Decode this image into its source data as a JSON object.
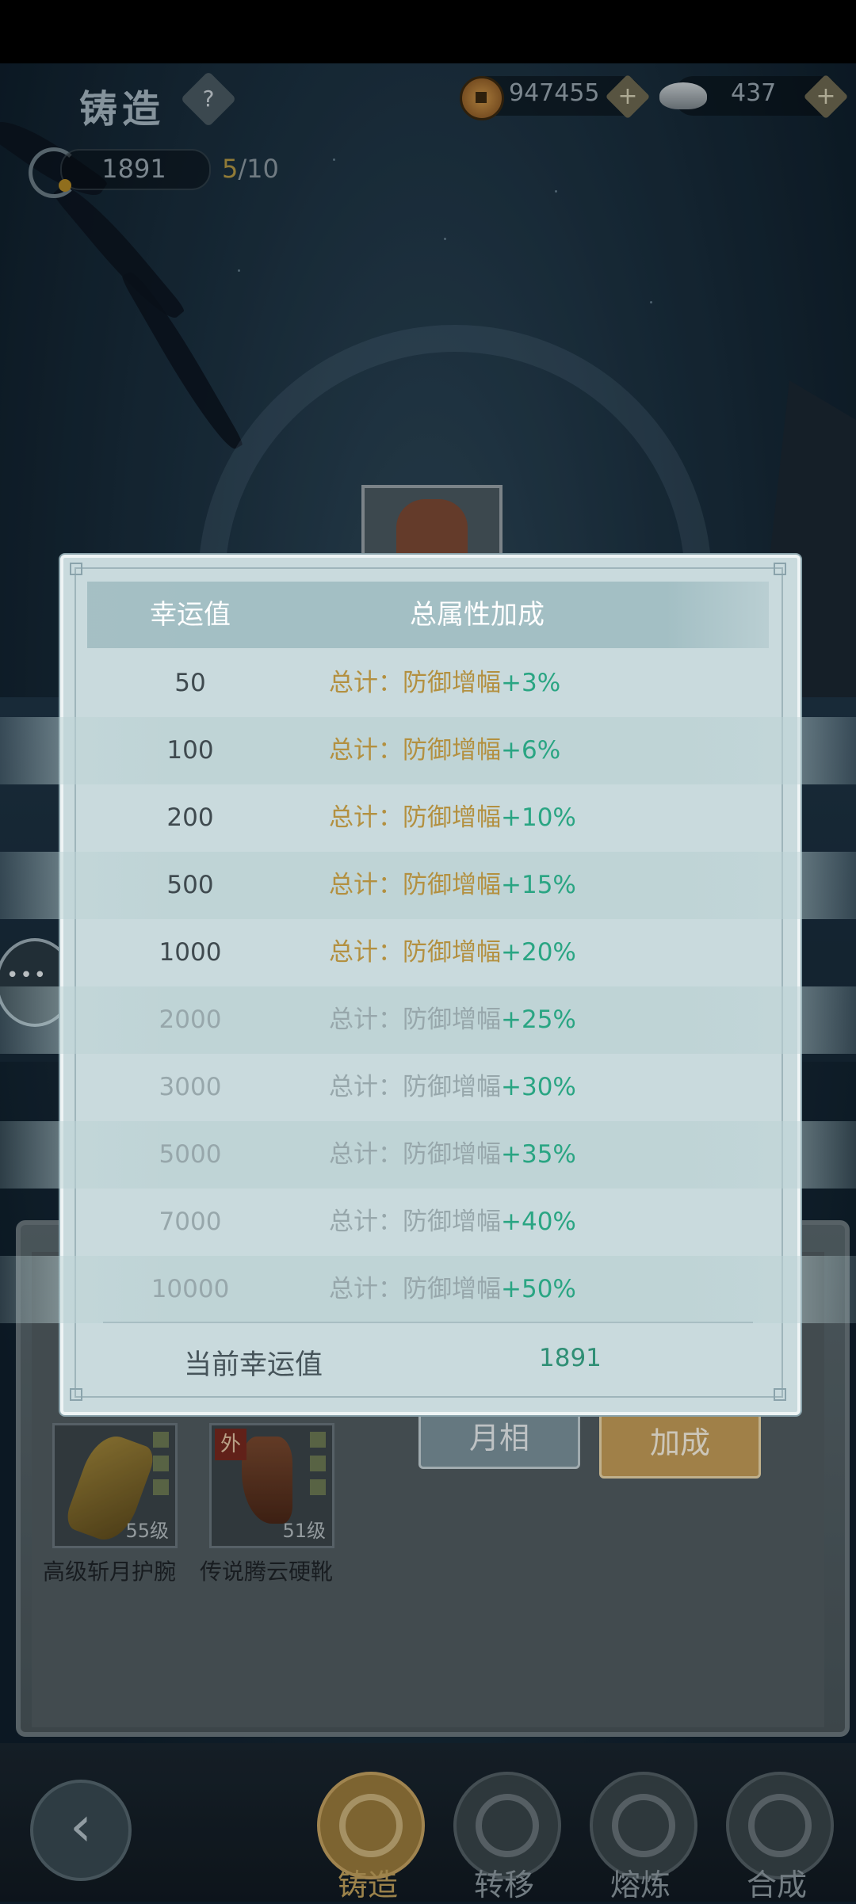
{
  "header": {
    "title": "铸造",
    "help_label": "?",
    "copper": "947455",
    "silver": "437",
    "add_label": "+"
  },
  "luck": {
    "value": "1891",
    "count_current": "5",
    "count_max": "/10"
  },
  "dialog": {
    "col_luck": "幸运值",
    "col_bonus": "总属性加成",
    "rows": [
      {
        "luck": "50",
        "label": "总计：防御增幅",
        "pct": "+3%",
        "active": true
      },
      {
        "luck": "100",
        "label": "总计：防御增幅",
        "pct": "+6%",
        "active": true
      },
      {
        "luck": "200",
        "label": "总计：防御增幅",
        "pct": "+10%",
        "active": true
      },
      {
        "luck": "500",
        "label": "总计：防御增幅",
        "pct": "+15%",
        "active": true
      },
      {
        "luck": "1000",
        "label": "总计：防御增幅",
        "pct": "+20%",
        "active": true
      },
      {
        "luck": "2000",
        "label": "总计：防御增幅",
        "pct": "+25%",
        "active": false
      },
      {
        "luck": "3000",
        "label": "总计：防御增幅",
        "pct": "+30%",
        "active": false
      },
      {
        "luck": "5000",
        "label": "总计：防御增幅",
        "pct": "+35%",
        "active": false
      },
      {
        "luck": "7000",
        "label": "总计：防御增幅",
        "pct": "+40%",
        "active": false
      },
      {
        "luck": "10000",
        "label": "总计：防御增幅",
        "pct": "+50%",
        "active": false
      }
    ],
    "current_label": "当前幸运值",
    "current_value": "1891"
  },
  "equipment": [
    {
      "name": "高级斩月护腕",
      "level": "55级",
      "tag": ""
    },
    {
      "name": "传说腾云硬靴",
      "level": "51级",
      "tag": "外"
    }
  ],
  "buttons": {
    "moon_phase": "月相",
    "bonus": "加成"
  },
  "nav": {
    "back_icon": "‹",
    "items": [
      "铸造",
      "转移",
      "熔炼",
      "合成"
    ],
    "active": "铸造"
  },
  "colors": {
    "active_text": "#b39040",
    "percent_text": "#2aa583",
    "inactive_text": "#97a7ab"
  }
}
